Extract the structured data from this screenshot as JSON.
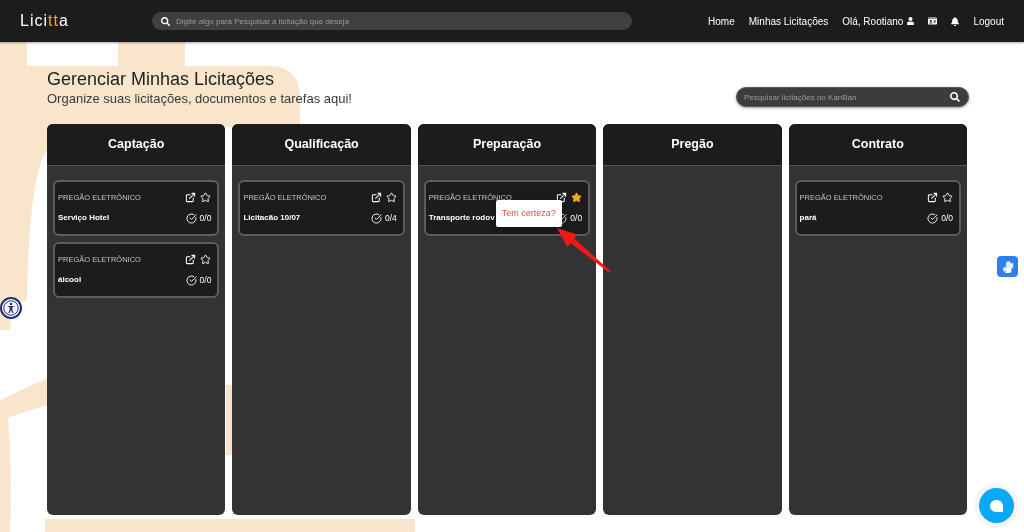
{
  "header": {
    "logo": [
      {
        "text": "Lici",
        "accent": false
      },
      {
        "text": "tt",
        "accent": true
      },
      {
        "text": "a",
        "accent": false
      }
    ],
    "search": {
      "placeholder": "Digite algo para Pesquisar a licitação que deseja"
    },
    "nav": [
      {
        "kind": "link",
        "label": "Home"
      },
      {
        "kind": "link",
        "label": "Minhas Licitações"
      },
      {
        "kind": "user",
        "label": "Olá, Rootiano"
      },
      {
        "kind": "dashboard"
      },
      {
        "kind": "notifications"
      },
      {
        "kind": "link",
        "label": "Logout"
      }
    ]
  },
  "page": {
    "title": "Gerenciar Minhas Licitações",
    "subtitle": "Organize suas licitações, documentos e tarefas aqui!",
    "search": {
      "placeholder": "Pesquisar licitações no KanBan"
    }
  },
  "columns": [
    {
      "title": "Captação",
      "cards": [
        {
          "type": "PREGÃO ELETRÔNICO",
          "title": "Serviço Hotel",
          "tasks": "0/0",
          "starred": false
        },
        {
          "type": "PREGÃO ELETRÔNICO",
          "title": "álcool",
          "tasks": "0/0",
          "starred": false
        }
      ]
    },
    {
      "title": "Qualificação",
      "cards": [
        {
          "type": "PREGÃO ELETRÔNICO",
          "title": "Licitacão 10/07",
          "tasks": "0/4",
          "starred": false
        }
      ]
    },
    {
      "title": "Preparação",
      "cards": [
        {
          "type": "PREGÃO ELETRÔNICO",
          "title": "Transporte rodov",
          "tasks": "0/0",
          "starred": true,
          "confirm_popover": "Tem certeza?"
        }
      ]
    },
    {
      "title": "Pregão"
    },
    {
      "title": "Contrato",
      "cards": [
        {
          "type": "PREGÃO ELETRÔNICO",
          "title": "pará",
          "tasks": "0/0",
          "starred": false
        }
      ]
    }
  ]
}
